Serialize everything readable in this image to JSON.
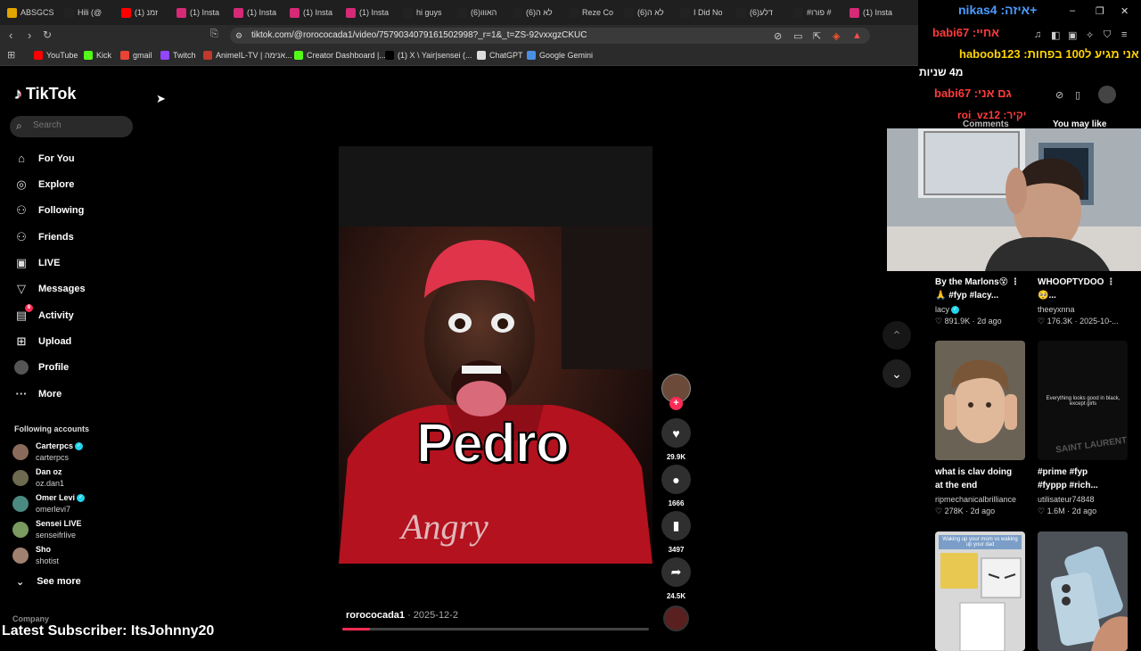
{
  "browser": {
    "tabs": [
      {
        "label": "ABSGCS",
        "color": "#e2a400"
      },
      {
        "label": "Hili (@",
        "color": "#222"
      },
      {
        "label": "(1) זמנ",
        "color": "#ff0000"
      },
      {
        "label": "(1) Insta",
        "color": "#d62976"
      },
      {
        "label": "(1) Insta",
        "color": "#d62976"
      },
      {
        "label": "(1) Insta",
        "color": "#d62976"
      },
      {
        "label": "(1) Insta",
        "color": "#d62976"
      },
      {
        "label": "hi guys",
        "color": "#222"
      },
      {
        "label": "(6)האווו",
        "color": "#222"
      },
      {
        "label": "(6)לא ה",
        "color": "#222"
      },
      {
        "label": "Reze Co",
        "color": "#222"
      },
      {
        "label": "(6)לא ה",
        "color": "#222"
      },
      {
        "label": "I Did No",
        "color": "#222"
      },
      {
        "label": "(6)דלע",
        "color": "#222"
      },
      {
        "label": "#פורו #",
        "color": "#222"
      },
      {
        "label": "(1) Insta",
        "color": "#d62976"
      }
    ],
    "url": "tiktok.com/@rorococada1/video/7579034079161502998?_r=1&_t=ZS-92vxxgzCKUC",
    "bookmarks": [
      {
        "label": "YouTube",
        "color": "#ff0000"
      },
      {
        "label": "Kick",
        "color": "#53fc18"
      },
      {
        "label": "gmail",
        "color": "#ea4335"
      },
      {
        "label": "Twitch",
        "color": "#9146ff"
      },
      {
        "label": "AnimeIL-TV | אנימה...",
        "color": "#c0392b"
      },
      {
        "label": "Creator Dashboard |...",
        "color": "#53fc18"
      },
      {
        "label": "(1) X \\ Yair|sensei (...",
        "color": "#000"
      },
      {
        "label": "ChatGPT",
        "color": "#ddd"
      },
      {
        "label": "Google Gemini",
        "color": "#4a90e2"
      }
    ]
  },
  "sidebar": {
    "logo": "TikTok",
    "search_placeholder": "Search",
    "nav": [
      {
        "label": "For You",
        "icon": "home-icon",
        "glyph": "⌂"
      },
      {
        "label": "Explore",
        "icon": "compass-icon",
        "glyph": "◎"
      },
      {
        "label": "Following",
        "icon": "following-icon",
        "glyph": "⚇"
      },
      {
        "label": "Friends",
        "icon": "friends-icon",
        "glyph": "⚇"
      },
      {
        "label": "LIVE",
        "icon": "live-icon",
        "glyph": "▣"
      },
      {
        "label": "Messages",
        "icon": "messages-icon",
        "glyph": "▽"
      },
      {
        "label": "Activity",
        "icon": "activity-icon",
        "glyph": "▤"
      },
      {
        "label": "Upload",
        "icon": "upload-icon",
        "glyph": "⊞"
      },
      {
        "label": "Profile",
        "icon": "profile-icon",
        "glyph": "●"
      },
      {
        "label": "More",
        "icon": "more-icon",
        "glyph": "···"
      }
    ],
    "activity_badge": "6",
    "following_title": "Following accounts",
    "following": [
      {
        "name": "Carterpcs",
        "handle": "carterpcs",
        "verified": true,
        "color": "#8a6a5a"
      },
      {
        "name": "Dan oz",
        "handle": "oz.dan1",
        "verified": false,
        "color": "#6d6a50"
      },
      {
        "name": "Omer Levi",
        "handle": "omerlevi7",
        "verified": true,
        "color": "#4a8a80"
      },
      {
        "name": "Sensei LIVE",
        "handle": "senseifrlive",
        "verified": false,
        "color": "#7a9a60"
      },
      {
        "name": "Sho",
        "handle": "shotist",
        "verified": false,
        "color": "#a08070"
      }
    ],
    "see_more": "See more",
    "company": "Company"
  },
  "video": {
    "caption": "Pedro",
    "author": "rorococada1",
    "date": " · 2025-12-2",
    "progress_fraction": 0.09
  },
  "actions": {
    "likes": "29.9K",
    "comments": "1666",
    "saves": "3497",
    "shares": "24.5K"
  },
  "stream_overlay": {
    "chat": [
      {
        "text": "nikas4 :איזה+",
        "color": "#4a9cff"
      },
      {
        "text": "babi67 :אחיי",
        "color": "#ff3b3b"
      },
      {
        "text": "haboob123 :אני מגיע ל100 בפחות",
        "color": "#ffd400"
      },
      {
        "text": "מ4 שניות",
        "color": "#ffffff"
      },
      {
        "text": "babi67 :גם אני",
        "color": "#ff3b3b"
      },
      {
        "text": "roi_vz12 :יקיר",
        "color": "#ff3b3b"
      }
    ],
    "latest_subscriber": "Latest Subscriber: ItsJohnny20"
  },
  "right_panel": {
    "tab_comments": "Comments",
    "tab_may_like": "You may like",
    "cards": [
      {
        "title1": "By the Marlons😵 ⋮",
        "title2": "🙏 #fyp #lacy...",
        "author": "lacy",
        "verified": true,
        "stats": "♡ 891.9K · 2d ago"
      },
      {
        "title1": "WHOOPTYDOO ⋮",
        "title2": "🥺...",
        "author": "theeyxnna",
        "verified": false,
        "stats": "♡ 176.3K · 2025-10-..."
      },
      {
        "title1": "what is clav doing",
        "title2": "at the end",
        "author": "ripmechanicalbrilliance",
        "verified": false,
        "stats": "♡ 278K · 2d ago"
      },
      {
        "title1": "#prime #fyp",
        "title2": "#fyppp #rich...",
        "author": "utilisateur74848",
        "verified": false,
        "stats": "♡ 1.6M · 2d ago"
      }
    ],
    "thumb_text_1": "Everything looks good in black, except girls",
    "thumb_text_2": "SAINT LAURENT",
    "thumb_text_3": "Waking up your mom vs waking up your dad"
  }
}
